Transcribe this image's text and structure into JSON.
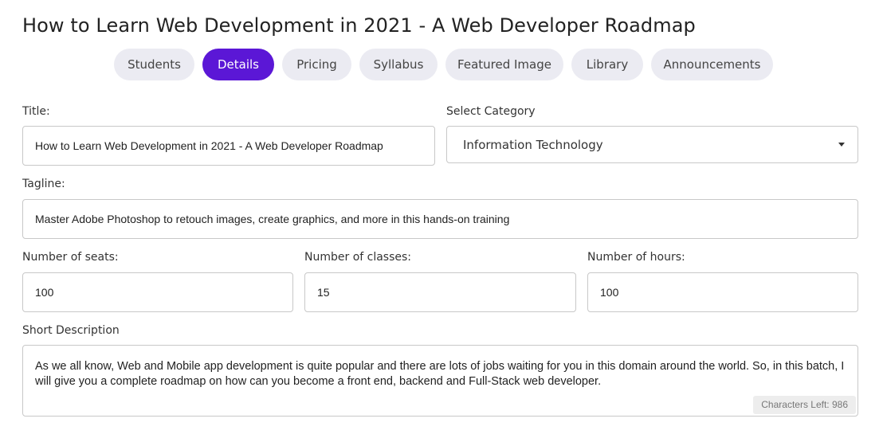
{
  "page": {
    "title": "How to Learn Web Development in 2021 - A Web Developer Roadmap"
  },
  "tabs": [
    {
      "label": "Students",
      "active": false
    },
    {
      "label": "Details",
      "active": true
    },
    {
      "label": "Pricing",
      "active": false
    },
    {
      "label": "Syllabus",
      "active": false
    },
    {
      "label": "Featured Image",
      "active": false
    },
    {
      "label": "Library",
      "active": false
    },
    {
      "label": "Announcements",
      "active": false
    }
  ],
  "form": {
    "title_label": "Title:",
    "title_value": "How to Learn Web Development in 2021 - A Web Developer Roadmap",
    "category_label": "Select Category",
    "category_value": "Information Technology",
    "tagline_label": "Tagline:",
    "tagline_value": "Master Adobe Photoshop to retouch images, create graphics, and more in this hands-on training",
    "seats_label": "Number of seats:",
    "seats_value": "100",
    "classes_label": "Number of classes:",
    "classes_value": "15",
    "hours_label": "Number of hours:",
    "hours_value": "100",
    "description_label": "Short Description",
    "description_value": "As we all know, Web and Mobile app development is quite popular and there are lots of jobs waiting for you in this domain around the world. So, in this batch, I will give you a complete roadmap on how can you become a front end, backend and Full-Stack web developer.",
    "characters_left": "Characters Left: 986"
  },
  "colors": {
    "accent": "#5b17d6",
    "tab_inactive_bg": "#ebebf2",
    "border": "#c8c8c8"
  },
  "icons": {
    "category_dropdown": "caret-down-icon"
  }
}
